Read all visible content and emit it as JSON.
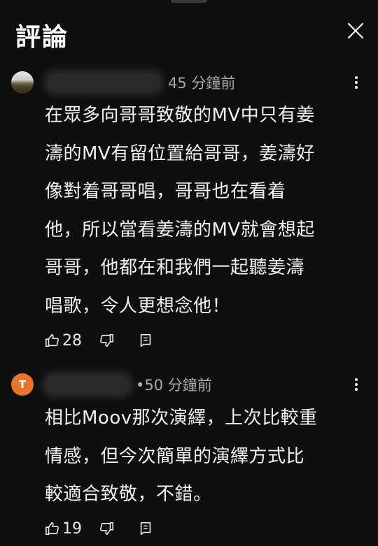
{
  "header": {
    "title": "評論"
  },
  "comments": [
    {
      "avatar": "photo-avatar",
      "time": "45 分鐘前",
      "text": "在眾多向哥哥致敬的MV中只有姜\n濤的MV有留位置給哥哥，姜濤好\n像對着哥哥唱，哥哥也在看着\n他，所以當看姜濤的MV就會想起\n哥哥，他都在和我們一起聽姜濤\n唱歌，令人更想念他！",
      "likes": "28"
    },
    {
      "avatar_letter": "T",
      "avatar_color": "#e8742c",
      "time": "•50 分鐘前",
      "text": "相比Moov那次演繹，上次比較重\n情感，但今次簡單的演繹方式比\n較適合致敬，不錯。",
      "likes": "19"
    }
  ],
  "colors": {
    "background": "#0f0f0f",
    "text_primary": "#f1f1f1",
    "text_secondary": "#aaaaaa",
    "avatar_accent": "#e8742c"
  },
  "icons": [
    "close-icon",
    "more-vertical-icon",
    "thumbs-up-icon",
    "thumbs-down-icon",
    "reply-icon"
  ]
}
